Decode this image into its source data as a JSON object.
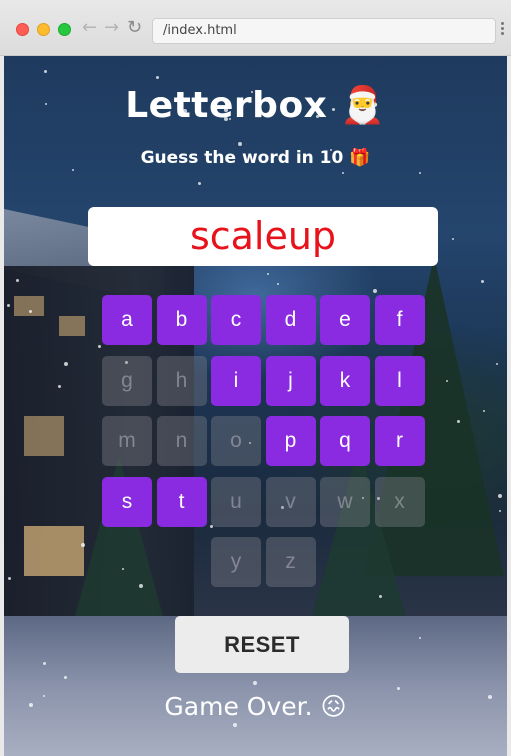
{
  "browser": {
    "url": "/index.html",
    "back_icon": "←",
    "forward_icon": "→",
    "reload_icon": "↻"
  },
  "game": {
    "title": "Letterbox 🎅",
    "subtitle": "Guess the word in 10 🎁",
    "word": "scaleup",
    "reset_label": "RESET",
    "status": "Game Over. 😖",
    "accent_color": "#8a2be2",
    "word_color": "#e8121a",
    "letters": [
      {
        "char": "a",
        "active": true
      },
      {
        "char": "b",
        "active": true
      },
      {
        "char": "c",
        "active": true
      },
      {
        "char": "d",
        "active": true
      },
      {
        "char": "e",
        "active": true
      },
      {
        "char": "f",
        "active": true
      },
      {
        "char": "g",
        "active": false
      },
      {
        "char": "h",
        "active": false
      },
      {
        "char": "i",
        "active": true
      },
      {
        "char": "j",
        "active": true
      },
      {
        "char": "k",
        "active": true
      },
      {
        "char": "l",
        "active": true
      },
      {
        "char": "m",
        "active": false
      },
      {
        "char": "n",
        "active": false
      },
      {
        "char": "o",
        "active": false
      },
      {
        "char": "p",
        "active": true
      },
      {
        "char": "q",
        "active": true
      },
      {
        "char": "r",
        "active": true
      },
      {
        "char": "s",
        "active": true
      },
      {
        "char": "t",
        "active": true
      },
      {
        "char": "u",
        "active": false
      },
      {
        "char": "v",
        "active": false
      },
      {
        "char": "w",
        "active": false
      },
      {
        "char": "x",
        "active": false
      },
      {
        "char": "y",
        "active": false
      },
      {
        "char": "z",
        "active": false
      }
    ]
  }
}
